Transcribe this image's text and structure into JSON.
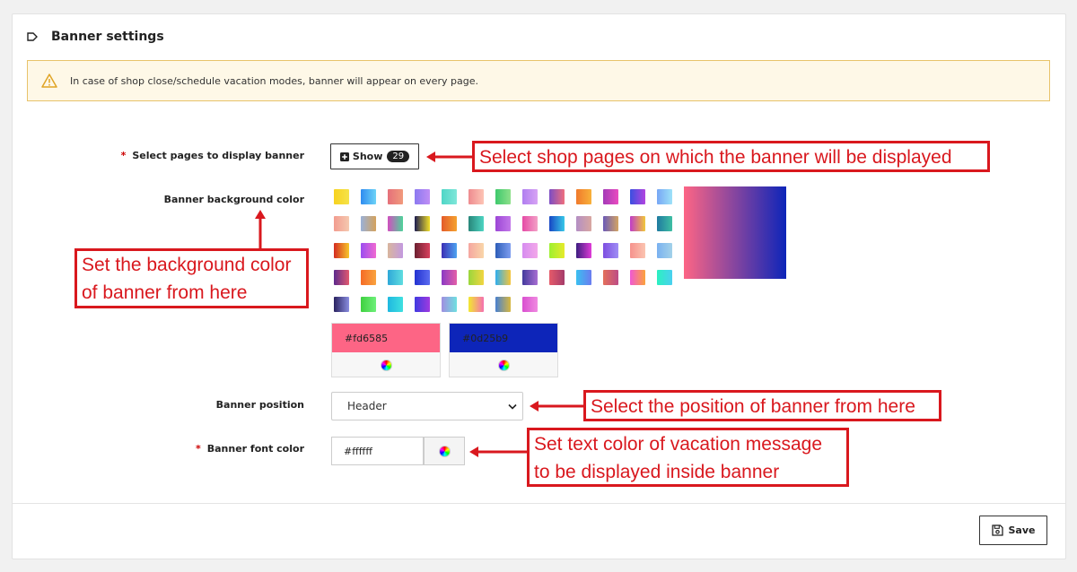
{
  "section": {
    "title": "Banner settings",
    "icon": "tag-icon"
  },
  "alert": {
    "icon": "warning-icon",
    "text": "In case of shop close/schedule vacation modes, banner will appear on every page."
  },
  "pages": {
    "required": "*",
    "label": "Select pages to display banner",
    "button_label": "Show",
    "count": "29"
  },
  "background": {
    "label": "Banner background color",
    "swatches": [
      [
        "#f7d21f,#f5e34a",
        "#2f8cf0,#6dd3f7",
        "#e5707a,#f19a7c",
        "#8b79f0,#c08ef5",
        "#4fd6c6,#7fe6d9",
        "#ee8b8f,#fdc4b5",
        "#3ec96c,#8ee08a",
        "#b07ef0,#d7a3f4",
        "#7c4dc4,#ef6f7d",
        "#f07a2c,#f8b13a",
        "#a33ab8,#ea4cc0",
        "#3a4fe0,#b244e0",
        "#77a6f5,#9de2f8"
      ],
      [
        "#f29c8f,#f5c9b0",
        "#9ab1d8,#d4a25c",
        "#d14fbf,#4dd49a",
        "#1c1c50,#f2e02a",
        "#e45b2a,#f4a22f",
        "#28867a,#4dd5c2",
        "#9c47d6,#c377e9",
        "#e54aa6,#f3a1c6",
        "#1846c4,#38c8e8",
        "#b48fc4,#d9a7a1",
        "#6b5ab8,#d3a463",
        "#c03cc8,#f0c839",
        "#1f7aa0,#3fbfa3"
      ],
      [
        "#d42b21,#f7c72a",
        "#9b4df0,#f06ad1",
        "#d9b69d,#c39ae0",
        "#6c2030,#d9415e",
        "#3b2fb5,#4ea3f0",
        "#f5a6a0,#f9d6a9",
        "#2d5db8,#7e9ef0",
        "#d68cf0,#f3a8e9",
        "#9ef030,#e6ea2c",
        "#3c1e80,#e03cd8",
        "#7d4ee0,#9f8ef5",
        "#f6928d,#fbc4b0",
        "#7ab1f0,#a3d2e9"
      ],
      [
        "#5d2a8c,#e2596f",
        "#f56b26,#f9a33f",
        "#2fa8d8,#5fdde0",
        "#2332d1,#5b6cf0",
        "#8b3ac4,#e35fa8",
        "#9ad63c,#f2d541",
        "#2eaef0,#f6c53a",
        "#433a9d,#a86fd2",
        "#e55b6a,#a53b6a",
        "#3ac0f0,#6b7cf0",
        "#e3705b,#bd4c86",
        "#f058d4,#fca33b",
        "#2bf0c0,#4bd0f0"
      ],
      [
        "#2a2260,#8a8ee0",
        "#3fd040,#6ef07a",
        "#1fb8e0,#3fe0e0",
        "#3f3ae0,#a03ae0",
        "#a08ee0,#6fe0e0",
        "#f2e830,#f570b0",
        "#4880d0,#d8b840",
        "#d94fd0,#f08ae0"
      ]
    ],
    "preview": "#fd6585,#0d25b9",
    "start": {
      "value": "#fd6585",
      "color": "#fd6585"
    },
    "end": {
      "value": "#0d25b9",
      "color": "#0d25b9"
    }
  },
  "position": {
    "label": "Banner position",
    "selected": "Header"
  },
  "font_color": {
    "required": "*",
    "label": "Banner font color",
    "value": "#ffffff"
  },
  "save": {
    "label": "Save"
  },
  "annotations": {
    "pages": "Select shop pages on which the banner will be displayed",
    "background_line1": "Set the background color",
    "background_line2": "of banner from here",
    "position": "Select the position of banner from here",
    "font_line1": "Set text color of vacation message",
    "font_line2": "to be displayed inside banner"
  },
  "colors": {
    "annotation_red": "#d9181e",
    "alert_bg": "#fef8e7",
    "alert_border": "#e8c36a"
  }
}
